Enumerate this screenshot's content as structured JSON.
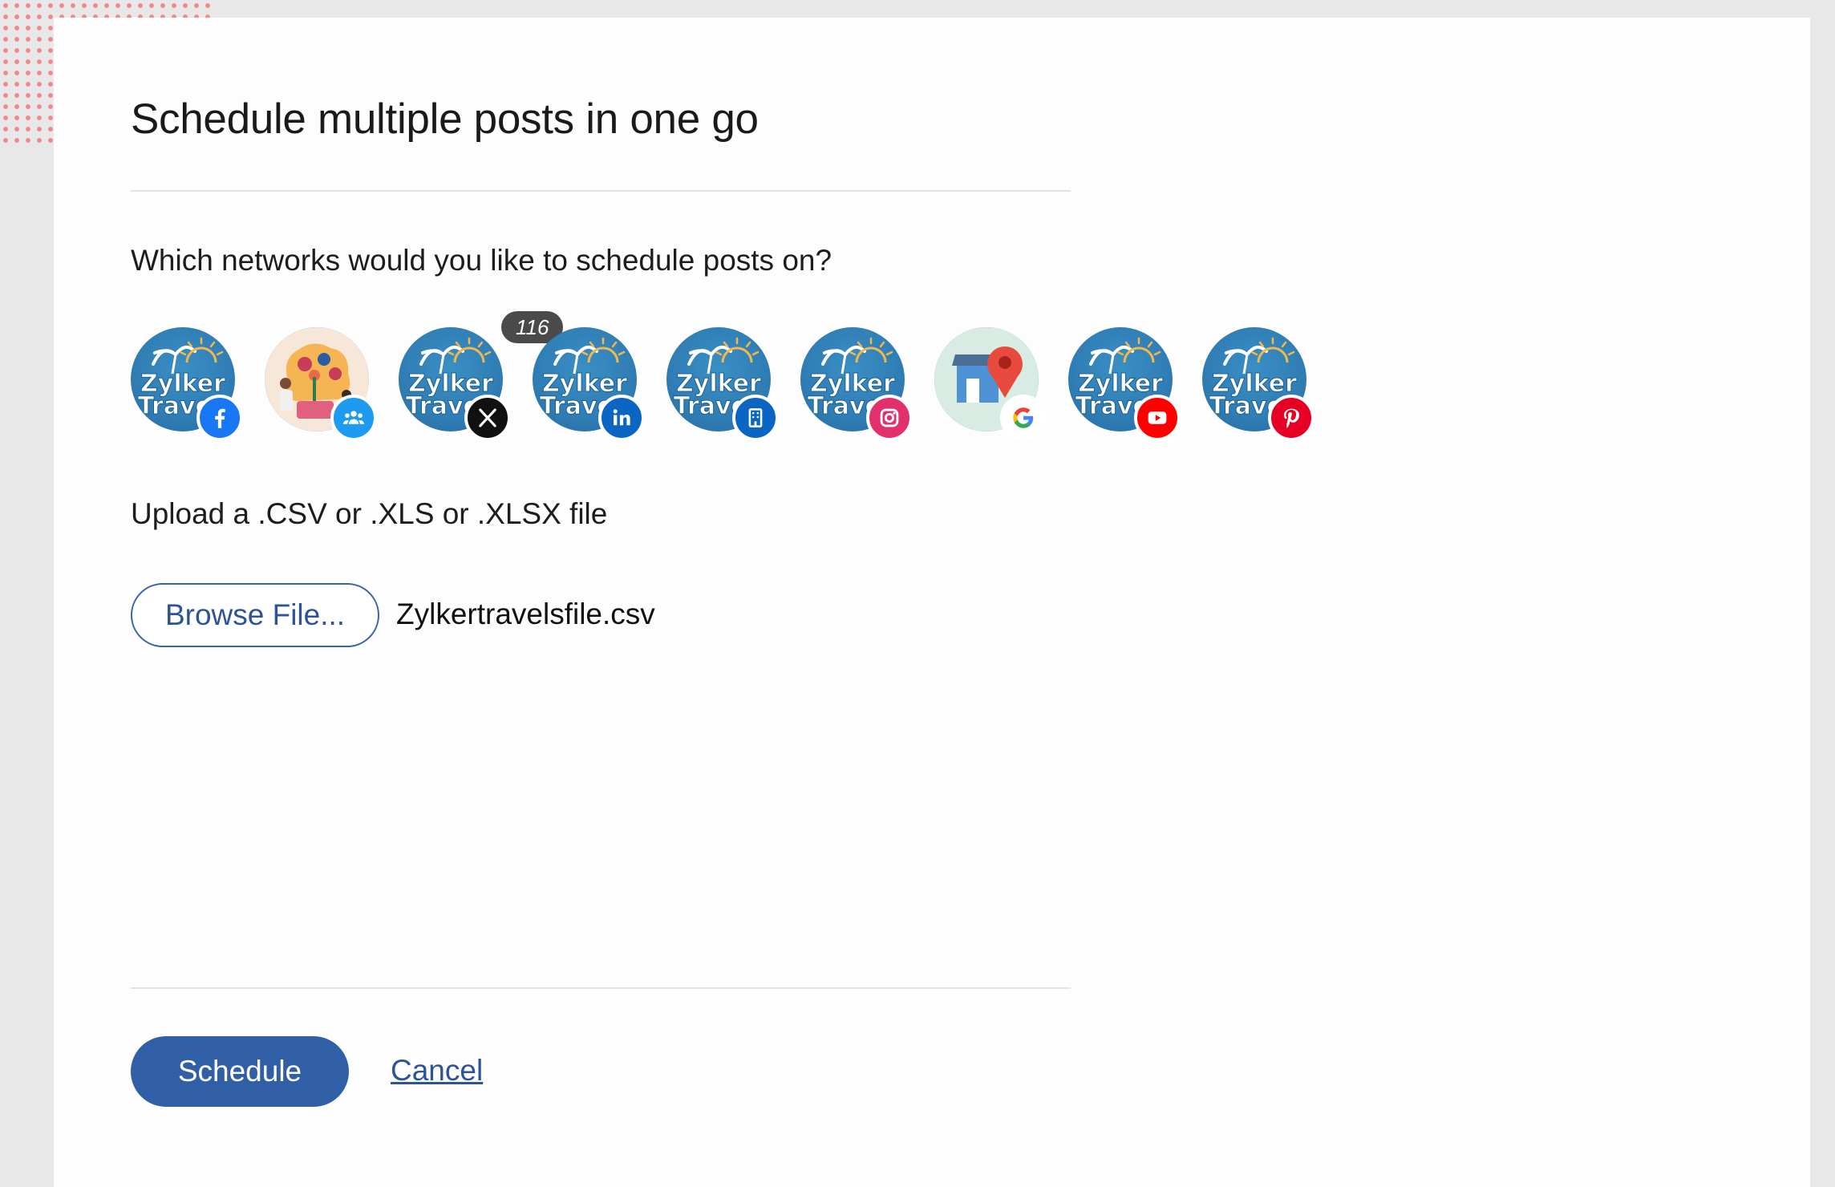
{
  "dialog": {
    "title": "Schedule multiple posts in one go",
    "networks_question": "Which networks would you like to schedule posts on?",
    "upload_label": "Upload a .CSV or .XLS or .XLSX file",
    "browse_label": "Browse File...",
    "file_name": "Zylkertravelsfile.csv",
    "schedule_label": "Schedule",
    "cancel_label": "Cancel"
  },
  "networks": [
    {
      "avatar_text": [
        "Zylker",
        "Travel"
      ],
      "network": "facebook-icon",
      "color": "#1877f2"
    },
    {
      "avatar_text": [],
      "network": "group-icon",
      "color": "#1d9bf0"
    },
    {
      "avatar_text": [
        "Zylker",
        "Travel"
      ],
      "network": "x-icon",
      "color": "#111111",
      "count": "116"
    },
    {
      "avatar_text": [
        "Zylker",
        "Travel"
      ],
      "network": "linkedin-icon",
      "color": "#0a66c2"
    },
    {
      "avatar_text": [
        "Zylker",
        "Travel"
      ],
      "network": "linkedin-page-icon",
      "color": "#0a66c2"
    },
    {
      "avatar_text": [
        "Zylker",
        "Travel"
      ],
      "network": "instagram-icon",
      "color": "#e1306c"
    },
    {
      "avatar_text": [],
      "network": "google-icon",
      "color": "#ffffff"
    },
    {
      "avatar_text": [
        "Zylker",
        "Travel"
      ],
      "network": "youtube-icon",
      "color": "#ff0000"
    },
    {
      "avatar_text": [
        "Zylker",
        "Travel"
      ],
      "network": "pinterest-icon",
      "color": "#e60023"
    }
  ],
  "colors": {
    "accent": "#315fa6",
    "panel_background": "#fdfdfd",
    "page_background": "#e8e8e8",
    "dots": "#f08a8a"
  }
}
